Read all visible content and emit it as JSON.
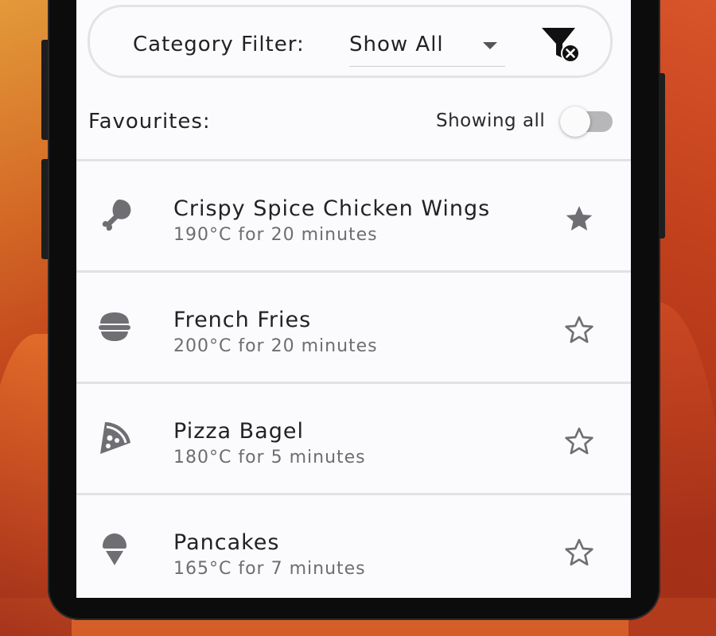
{
  "filter": {
    "label": "Category Filter:",
    "selected": "Show All",
    "clear_icon": "filter-clear-icon"
  },
  "favourites": {
    "label": "Favourites:",
    "status": "Showing all",
    "toggle_on": false
  },
  "recipes": [
    {
      "icon": "drumstick-icon",
      "title": "Crispy Spice Chicken Wings",
      "subtitle": "190°C for 20 minutes",
      "favourite": true
    },
    {
      "icon": "bowl-icon",
      "title": "French Fries",
      "subtitle": "200°C for 20 minutes",
      "favourite": false
    },
    {
      "icon": "pizza-slice-icon",
      "title": "Pizza Bagel",
      "subtitle": "180°C for 5 minutes",
      "favourite": false
    },
    {
      "icon": "ice-cream-icon",
      "title": "Pancakes",
      "subtitle": "165°C for 7 minutes",
      "favourite": false
    }
  ],
  "colors": {
    "icon": "#6f6f73",
    "star": "#6f6f73",
    "divider": "#e2e2e6",
    "screen_bg": "#fbfbfe"
  }
}
